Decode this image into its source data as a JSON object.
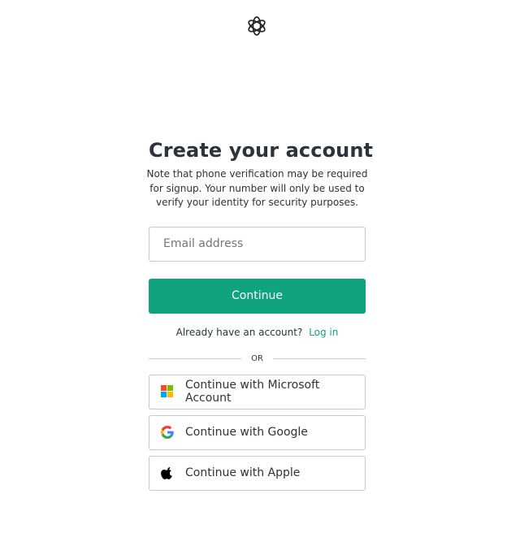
{
  "header": {
    "logo_icon": "openai-logo-icon"
  },
  "main": {
    "title": "Create your account",
    "note": "Note that phone verification may be required for signup. Your number will only be used to verify your identity for security purposes.",
    "email": {
      "placeholder": "Email address",
      "value": ""
    },
    "continue_label": "Continue",
    "login_prompt": "Already have an account?",
    "login_link": "Log in",
    "divider_text": "OR",
    "social": [
      {
        "label": "Continue with Microsoft Account",
        "icon": "microsoft-icon"
      },
      {
        "label": "Continue with Google",
        "icon": "google-icon"
      },
      {
        "label": "Continue with Apple",
        "icon": "apple-icon"
      }
    ]
  },
  "colors": {
    "accent": "#10a37f",
    "text": "#2d333a",
    "border": "#c2c8d0",
    "microsoft": [
      "#f25022",
      "#7fba00",
      "#00a4ef",
      "#ffb900"
    ]
  }
}
